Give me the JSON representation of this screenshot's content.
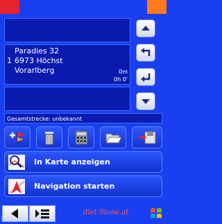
{
  "route": {
    "entry_index": "1",
    "address": [
      "Paradies 32",
      "6973 Höchst",
      "Vorarlberg"
    ],
    "distance": "0m",
    "time": "0h 0'"
  },
  "status": {
    "total_distance": "Gesamtstrecke: unbekannt"
  },
  "actions": {
    "show_on_map": "In Karte anzeigen",
    "start_navigation": "Navigation starten"
  },
  "watermark": "diet-Stone.at",
  "colors": {
    "background": "#1a3ff0",
    "panel": "#0b1bb0",
    "accent": "#e8232e"
  }
}
